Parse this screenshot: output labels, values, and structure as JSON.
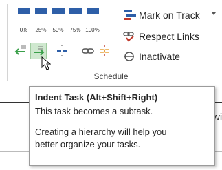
{
  "ribbon": {
    "group_label": "Schedule",
    "percent_buttons": [
      {
        "label": "0%",
        "fill": 0.0
      },
      {
        "label": "25%",
        "fill": 0.25
      },
      {
        "label": "50%",
        "fill": 0.5
      },
      {
        "label": "75%",
        "fill": 0.75
      },
      {
        "label": "100%",
        "fill": 1.0
      }
    ],
    "mark_on_track": "Mark on Track",
    "respect_links": "Respect Links",
    "inactivate": "Inactivate",
    "colors": {
      "accent_blue": "#2e5fa8",
      "green": "#3aa04a",
      "red": "#c0392b",
      "hover_green": "#cfe8cf"
    }
  },
  "tooltip": {
    "title": "Indent Task (Alt+Shift+Right)",
    "line1": "This task becomes a subtask.",
    "line2": "Creating a hierarchy will help you",
    "line3": "better organize your tasks."
  },
  "sheet": {
    "partial_text": "wi"
  }
}
